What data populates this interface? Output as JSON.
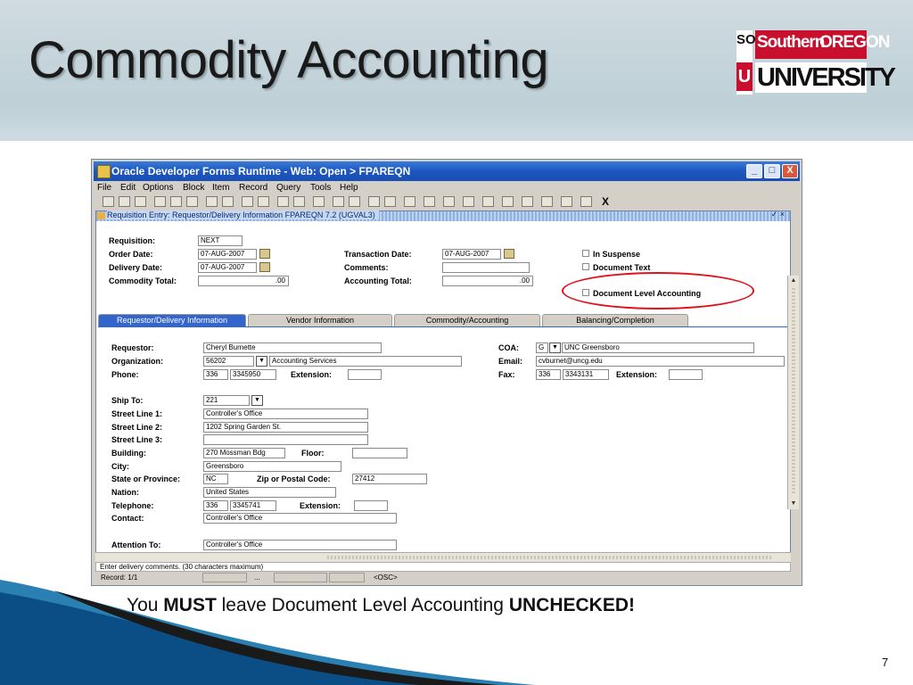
{
  "slide": {
    "title": "Commodity Accounting",
    "caption_1": "You ",
    "caption_2": "MUST",
    "caption_3": " leave Document Level Accounting ",
    "caption_4": "UNCHECKED!",
    "page_number": "7",
    "logo": {
      "so_top": "SO",
      "so_bottom": "U",
      "line1a": "Southern",
      "line1b": "OREGON",
      "line2": "UNIVERSITY"
    },
    "colors": {
      "logo_red": "#c8102e",
      "highlight_oval": "#e0121c",
      "title_bar": "#1c56c0"
    }
  },
  "window": {
    "title": "Oracle Developer Forms Runtime - Web:  Open > FPAREQN",
    "controls": [
      "_",
      "□",
      "X"
    ],
    "menu": [
      "File",
      "Edit",
      "Options",
      "Block",
      "Item",
      "Record",
      "Query",
      "Tools",
      "Help"
    ],
    "toolbar_close": "X",
    "form_title": "Requisition Entry: Requestor/Delivery Information  FPAREQN  7.2  (UGVAL3)",
    "form_close": "✓ ×"
  },
  "header": {
    "requisition_label": "Requisition:",
    "requisition_value": "NEXT",
    "order_date_label": "Order Date:",
    "order_date_value": "07-AUG-2007",
    "delivery_date_label": "Delivery Date:",
    "delivery_date_value": "07-AUG-2007",
    "commodity_total_label": "Commodity Total:",
    "commodity_total_value": ".00",
    "transaction_date_label": "Transaction Date:",
    "transaction_date_value": "07-AUG-2007",
    "comments_label": "Comments:",
    "comments_value": "",
    "accounting_total_label": "Accounting Total:",
    "accounting_total_value": ".00",
    "in_suspense_label": "In Suspense",
    "document_text_label": "Document Text",
    "document_level_accounting_label": "Document Level Accounting"
  },
  "tabs": [
    "Requestor/Delivery Information",
    "Vendor Information",
    "Commodity/Accounting",
    "Balancing/Completion"
  ],
  "requestor": {
    "requestor_label": "Requestor:",
    "requestor_value": "Cheryl Burnette",
    "organization_label": "Organization:",
    "organization_code": "56202",
    "organization_name": "Accounting Services",
    "phone_label": "Phone:",
    "phone_area": "336",
    "phone_number": "3345950",
    "extension_label": "Extension:",
    "extension_value": "",
    "coa_label": "COA:",
    "coa_code": "G",
    "coa_name": "UNC Greensboro",
    "email_label": "Email:",
    "email_value": "cvburnet@uncg.edu",
    "fax_label": "Fax:",
    "fax_area": "336",
    "fax_number": "3343131",
    "fax_extension_label": "Extension:",
    "fax_extension_value": ""
  },
  "delivery": {
    "ship_to_label": "Ship To:",
    "ship_to_value": "221",
    "street1_label": "Street Line 1:",
    "street1_value": "Controller's Office",
    "street2_label": "Street Line 2:",
    "street2_value": "1202 Spring Garden St.",
    "street3_label": "Street Line 3:",
    "street3_value": "",
    "building_label": "Building:",
    "building_value": "270 Mossman Bdg",
    "floor_label": "Floor:",
    "floor_value": "",
    "city_label": "City:",
    "city_value": "Greensboro",
    "state_label": "State or Province:",
    "state_value": "NC",
    "zip_label": "Zip or Postal Code:",
    "zip_value": "27412",
    "nation_label": "Nation:",
    "nation_value": "United States",
    "telephone_label": "Telephone:",
    "tel_area": "336",
    "tel_number": "3345741",
    "tel_extension_label": "Extension:",
    "tel_extension_value": "",
    "contact_label": "Contact:",
    "contact_value": "Controller's Office",
    "attention_label": "Attention To:",
    "attention_value": "Controller's Office"
  },
  "status": {
    "hint": "Enter delivery comments. (30 characters maximum)",
    "record": "Record: 1/1",
    "dots": "...",
    "osc": "<OSC>"
  }
}
